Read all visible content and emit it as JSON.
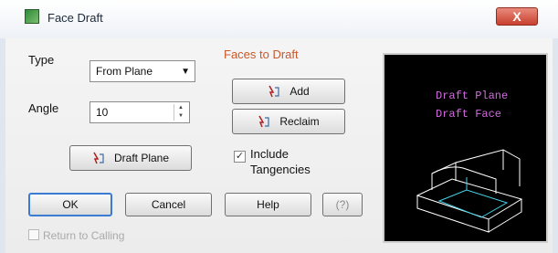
{
  "window": {
    "title": "Face Draft",
    "close_label": "X"
  },
  "form": {
    "type_label": "Type",
    "type_value": "From Plane",
    "angle_label": "Angle",
    "angle_value": "10",
    "draft_plane_label": "Draft Plane"
  },
  "faces": {
    "heading": "Faces to Draft",
    "add_label": "Add",
    "reclaim_label": "Reclaim",
    "include_tangencies_label": "Include Tangencies",
    "include_tangencies_checked": true
  },
  "footer": {
    "ok_label": "OK",
    "cancel_label": "Cancel",
    "help_label": "Help",
    "extra_label": "(?)",
    "return_label": "Return to Calling",
    "return_checked": false
  },
  "preview": {
    "line1": "Draft Plane",
    "line2": "Draft Face"
  },
  "colors": {
    "accent_heading": "#c9582a",
    "preview_bg": "#000000",
    "preview_text": "#d36be0",
    "preview_lines": "#ffffff"
  }
}
